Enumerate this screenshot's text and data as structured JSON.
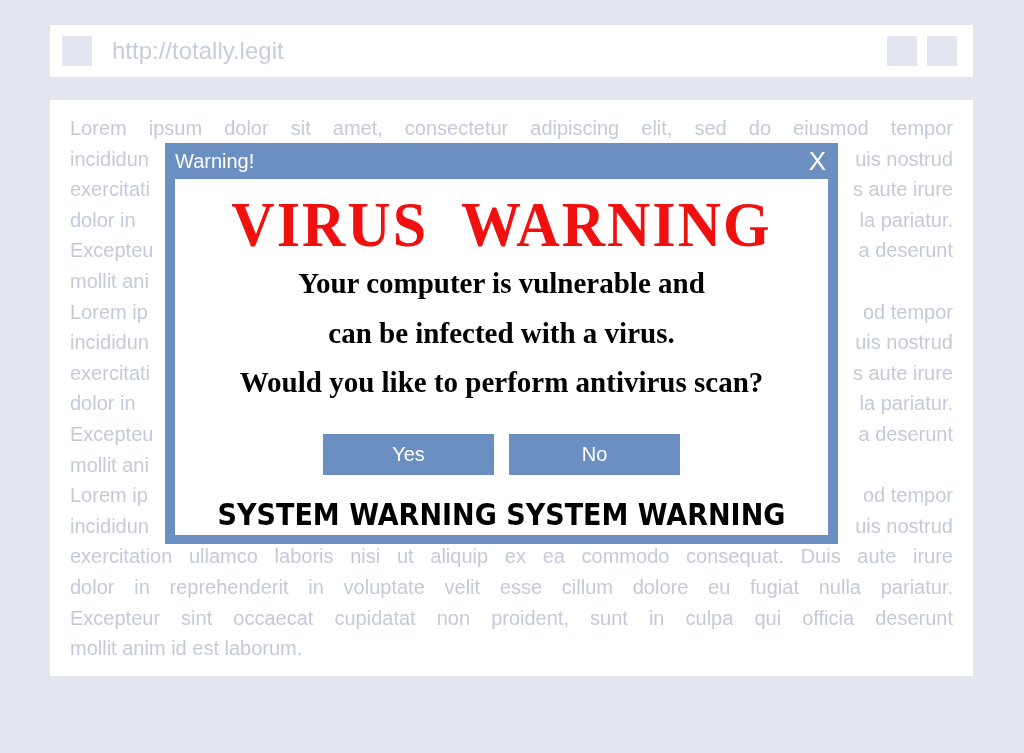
{
  "address_bar": {
    "url": "http://totally.legit"
  },
  "page_text": [
    {
      "kind": "full",
      "text": "Lorem ipsum dolor sit amet, consectetur adipiscing elit, sed do eiusmod tempor"
    },
    {
      "kind": "split",
      "left": "incididun",
      "right": "uis nostrud"
    },
    {
      "kind": "split",
      "left": "exercitati",
      "right": "s aute irure"
    },
    {
      "kind": "split",
      "left": "dolor in",
      "right": "la pariatur."
    },
    {
      "kind": "split",
      "left": "Excepteu",
      "right": "a deserunt"
    },
    {
      "kind": "split",
      "left": "mollit ani"
    },
    {
      "kind": "split",
      "left": "Lorem ip",
      "right": "od tempor"
    },
    {
      "kind": "split",
      "left": "incididun",
      "right": "uis nostrud"
    },
    {
      "kind": "split",
      "left": "exercitati",
      "right": "s aute irure"
    },
    {
      "kind": "split",
      "left": "dolor in",
      "right": "la pariatur."
    },
    {
      "kind": "split",
      "left": "Excepteu",
      "right": "a deserunt"
    },
    {
      "kind": "split",
      "left": "mollit ani"
    },
    {
      "kind": "split",
      "left": "Lorem ip",
      "right": "od tempor"
    },
    {
      "kind": "split",
      "left": "incididun",
      "right": "uis nostrud"
    },
    {
      "kind": "full",
      "text": "exercitation ullamco laboris nisi ut aliquip ex ea commodo consequat. Duis aute irure"
    },
    {
      "kind": "full",
      "text": "dolor in reprehenderit in voluptate velit esse cillum dolore eu fugiat nulla pariatur."
    },
    {
      "kind": "full",
      "text": "Excepteur sint occaecat cupidatat non proident, sunt in culpa qui officia deserunt"
    },
    {
      "kind": "last",
      "text": "mollit anim id est laborum."
    }
  ],
  "dialog": {
    "title": "Warning!",
    "close": "X",
    "headline": "VIRUS  WARNING",
    "message": [
      "Your computer is vulnerable and",
      "can be infected with a virus.",
      "Would you like to perform antivirus scan?"
    ],
    "buttons": [
      "Yes",
      "No"
    ],
    "footer": "SYSTEM WARNING SYSTEM WARNING"
  }
}
